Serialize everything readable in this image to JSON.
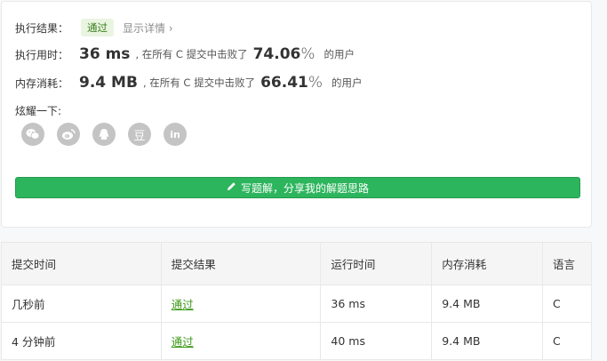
{
  "result": {
    "label": "执行结果：",
    "status": "通过",
    "detail_link": "显示详情 ›"
  },
  "runtime": {
    "label": "执行用时：",
    "value": "36 ms",
    "middle": ", 在所有 C 提交中击败了",
    "percent": "74.06",
    "pct_sign": "%",
    "tail": "的用户"
  },
  "memory": {
    "label": "内存消耗：",
    "value": "9.4 MB",
    "middle": ", 在所有 C 提交中击败了",
    "percent": "66.41",
    "pct_sign": "%",
    "tail": "的用户"
  },
  "share": {
    "label": "炫耀一下:",
    "icons": [
      "wechat-icon",
      "weibo-icon",
      "qq-icon",
      "douban-icon",
      "linkedin-icon"
    ],
    "douban_glyph": "豆",
    "linkedin_glyph": "in"
  },
  "cta": {
    "label": "写题解，分享我的解题思路"
  },
  "table": {
    "headers": [
      "提交时间",
      "提交结果",
      "运行时间",
      "内存消耗",
      "语言"
    ],
    "rows": [
      [
        "几秒前",
        "通过",
        "36 ms",
        "9.4 MB",
        "C"
      ],
      [
        "4 分钟前",
        "通过",
        "40 ms",
        "9.4 MB",
        "C"
      ]
    ]
  },
  "colors": {
    "accent_green": "#2db55d",
    "pass_text": "#3e9a19",
    "icon_grey": "#c4c4c4"
  }
}
